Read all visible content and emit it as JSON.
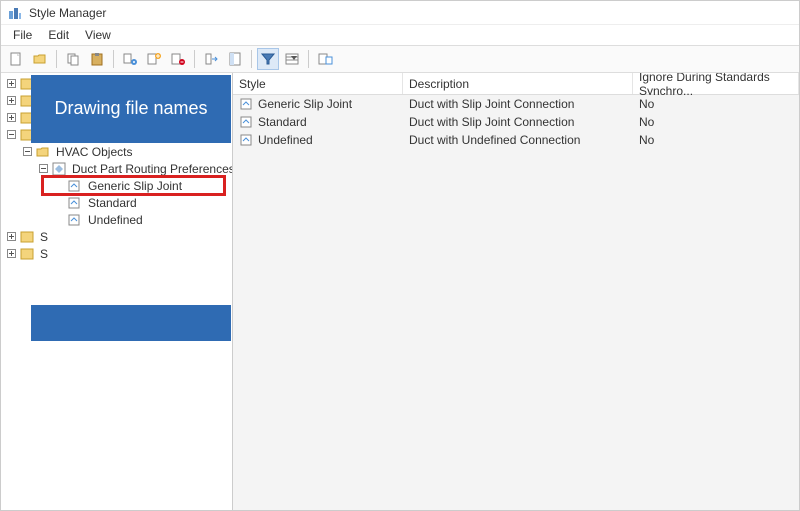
{
  "window": {
    "title": "Style Manager"
  },
  "menubar": {
    "file": "File",
    "edit": "Edit",
    "view": "View"
  },
  "overlay": {
    "text": "Drawing file names"
  },
  "tree": {
    "hvac": "HVAC Objects",
    "routing": "Duct Part Routing Preferences",
    "items": [
      {
        "label": "Generic Slip Joint"
      },
      {
        "label": "Standard"
      },
      {
        "label": "Undefined"
      }
    ],
    "s1": "S",
    "s2": "S"
  },
  "columns": {
    "style": "Style",
    "desc": "Description",
    "ignore": "Ignore During Standards Synchro..."
  },
  "rows": [
    {
      "style": "Generic Slip Joint",
      "desc": "Duct with Slip Joint Connection",
      "ignore": "No"
    },
    {
      "style": "Standard",
      "desc": "Duct with Slip Joint Connection",
      "ignore": "No"
    },
    {
      "style": "Undefined",
      "desc": "Duct with Undefined Connection",
      "ignore": "No"
    }
  ]
}
